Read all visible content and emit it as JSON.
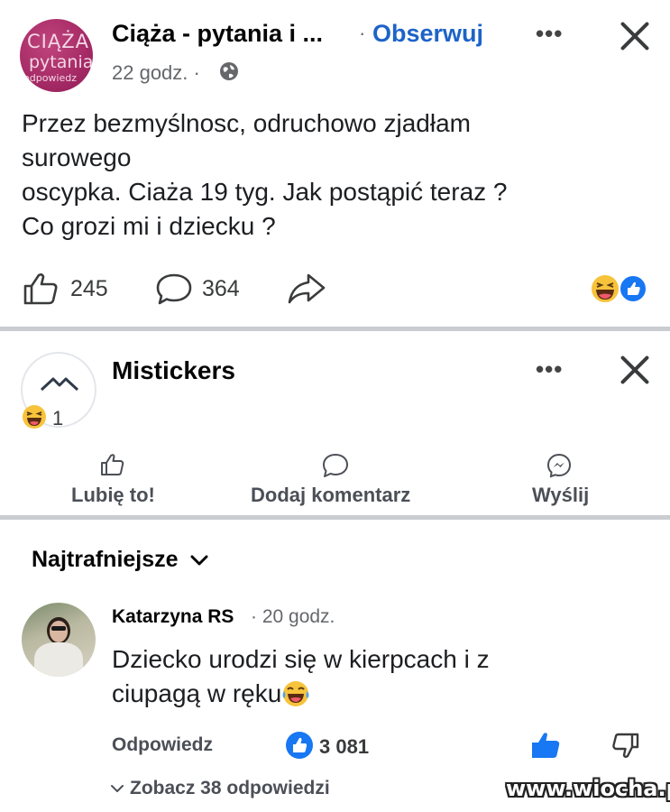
{
  "post": {
    "avatar_line1": "CIĄŻA",
    "avatar_line2": "pytania",
    "avatar_line3": "odpowiedz",
    "group_name": "Ciąża - pytania i ...",
    "separator": "·",
    "follow_label": "Obserwuj",
    "time": "22 godz. ·",
    "body_lines": [
      "Przez bezmyślnosc, odruchowo zjadłam",
      "surowego",
      "oscypka. Ciaża 19 tyg. Jak postąpić teraz ?",
      "Co grozi mi i dziecku ?"
    ],
    "like_count": "245",
    "comment_count": "364"
  },
  "ad": {
    "name": "Mistickers",
    "reaction_count": "1",
    "actions": {
      "like": "Lubię to!",
      "comment": "Dodaj komentarz",
      "send": "Wyślij"
    }
  },
  "comments": {
    "sort_label": "Najtrafniejsze",
    "author": "Katarzyna RS",
    "time": "· 20 godz.",
    "text_lines": [
      "Dziecko urodzi się w kierpcach i z",
      "ciupagą w ręku"
    ],
    "reply_label": "Odpowiedz",
    "like_count": "3 081",
    "see_replies": "Zobacz 38 odpowiedzi"
  },
  "watermark": "www.wiocha.pl",
  "colors": {
    "follow": "#1d63c8",
    "like_blue": "#1877f2",
    "divider": "#c9ccd1",
    "avatar_pink": "#a52a65"
  },
  "icons": [
    "globe-icon",
    "more-icon",
    "close-icon",
    "like-icon",
    "comment-icon",
    "share-icon",
    "haha-emoji-icon",
    "messenger-icon",
    "chevron-down-icon",
    "dislike-icon"
  ]
}
